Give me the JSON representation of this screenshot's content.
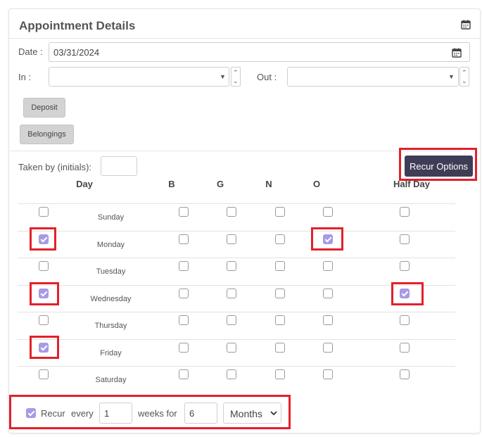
{
  "header": {
    "title": "Appointment Details",
    "icon": "calendar-icon"
  },
  "date": {
    "label": "Date :",
    "value": "03/31/2024",
    "button_icon": "calendar-icon"
  },
  "in_field": {
    "label": "In :",
    "value": ""
  },
  "out_field": {
    "label": "Out :",
    "value": ""
  },
  "buttons": {
    "deposit": "Deposit",
    "belongings": "Belongings",
    "recur_options": "Recur Options"
  },
  "taken_by": {
    "label": "Taken by (initials):",
    "value": ""
  },
  "table": {
    "columns": [
      "Day",
      "B",
      "G",
      "N",
      "O",
      "Half Day"
    ],
    "rows": [
      {
        "day": "Sunday",
        "day_checked": false,
        "B": false,
        "G": false,
        "N": false,
        "O": false,
        "half_day": false
      },
      {
        "day": "Monday",
        "day_checked": true,
        "B": false,
        "G": false,
        "N": false,
        "O": true,
        "half_day": false
      },
      {
        "day": "Tuesday",
        "day_checked": false,
        "B": false,
        "G": false,
        "N": false,
        "O": false,
        "half_day": false
      },
      {
        "day": "Wednesday",
        "day_checked": true,
        "B": false,
        "G": false,
        "N": false,
        "O": false,
        "half_day": true
      },
      {
        "day": "Thursday",
        "day_checked": false,
        "B": false,
        "G": false,
        "N": false,
        "O": false,
        "half_day": false
      },
      {
        "day": "Friday",
        "day_checked": true,
        "B": false,
        "G": false,
        "N": false,
        "O": false,
        "half_day": false
      },
      {
        "day": "Saturday",
        "day_checked": false,
        "B": false,
        "G": false,
        "N": false,
        "O": false,
        "half_day": false
      }
    ]
  },
  "recur": {
    "checked": true,
    "label": "Recur",
    "every_label": "every",
    "every_value": "1",
    "weeks_for_label": "weeks for",
    "duration_value": "6",
    "unit_selected": "Months"
  },
  "colors": {
    "accent": "#a59be6",
    "button_dark": "#3f3d56",
    "highlight": "#e3202a"
  }
}
